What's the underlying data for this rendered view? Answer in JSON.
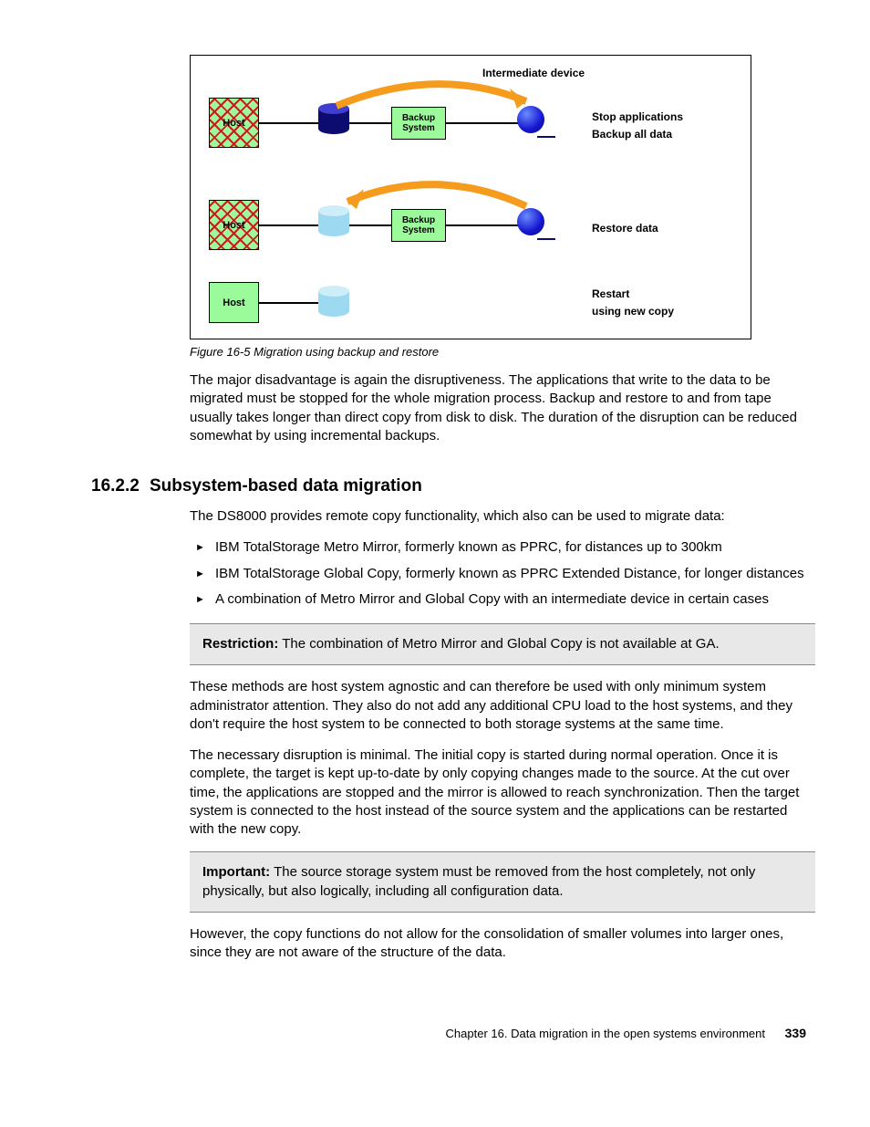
{
  "figure": {
    "intermediate_label": "Intermediate device",
    "host_label": "Host",
    "backup_label": "Backup System",
    "row1_text_a": "Stop applications",
    "row1_text_b": "Backup all data",
    "row2_text": "Restore data",
    "row3_text_a": "Restart",
    "row3_text_b": "using new copy",
    "caption": "Figure 16-5   Migration using backup and restore"
  },
  "para1": "The major disadvantage is again the disruptiveness. The applications that write to the data to be migrated must be stopped for the whole migration process. Backup and restore to and from tape usually takes longer than direct copy from disk to disk. The duration of the disruption can be reduced somewhat by using incremental backups.",
  "section": {
    "number": "16.2.2",
    "title": "Subsystem-based data migration"
  },
  "para2": "The DS8000 provides remote copy functionality, which also can be used to migrate data:",
  "bullets": [
    "IBM TotalStorage Metro Mirror, formerly known as PPRC, for distances up to 300km",
    "IBM TotalStorage Global Copy, formerly known as PPRC Extended Distance, for longer distances",
    "A combination of Metro Mirror and Global Copy with an intermediate device in certain cases"
  ],
  "restriction": {
    "label": "Restriction:",
    "text": " The combination of Metro Mirror and Global Copy is not available at GA."
  },
  "para3": "These methods are host system agnostic and can therefore be used with only minimum system administrator attention. They also do not add any additional CPU load to the host systems, and they don't require the host system to be connected to both storage systems at the same time.",
  "para4": "The necessary disruption is minimal. The initial copy is started during normal operation. Once it is complete, the target is kept up-to-date by only copying changes made to the source. At the cut over time, the applications are stopped and the mirror is allowed to reach synchronization. Then the target system is connected to the host instead of the source system and the applications can be restarted with the new copy.",
  "important": {
    "label": "Important:",
    "text": " The source storage system must be removed from the host completely, not only physically, but also logically, including all configuration data."
  },
  "para5": "However, the copy functions do not allow for the consolidation of smaller volumes into larger ones, since they are not aware of the structure of the data.",
  "footer": {
    "chapter": "Chapter 16. Data migration in the open systems environment",
    "page": "339"
  }
}
